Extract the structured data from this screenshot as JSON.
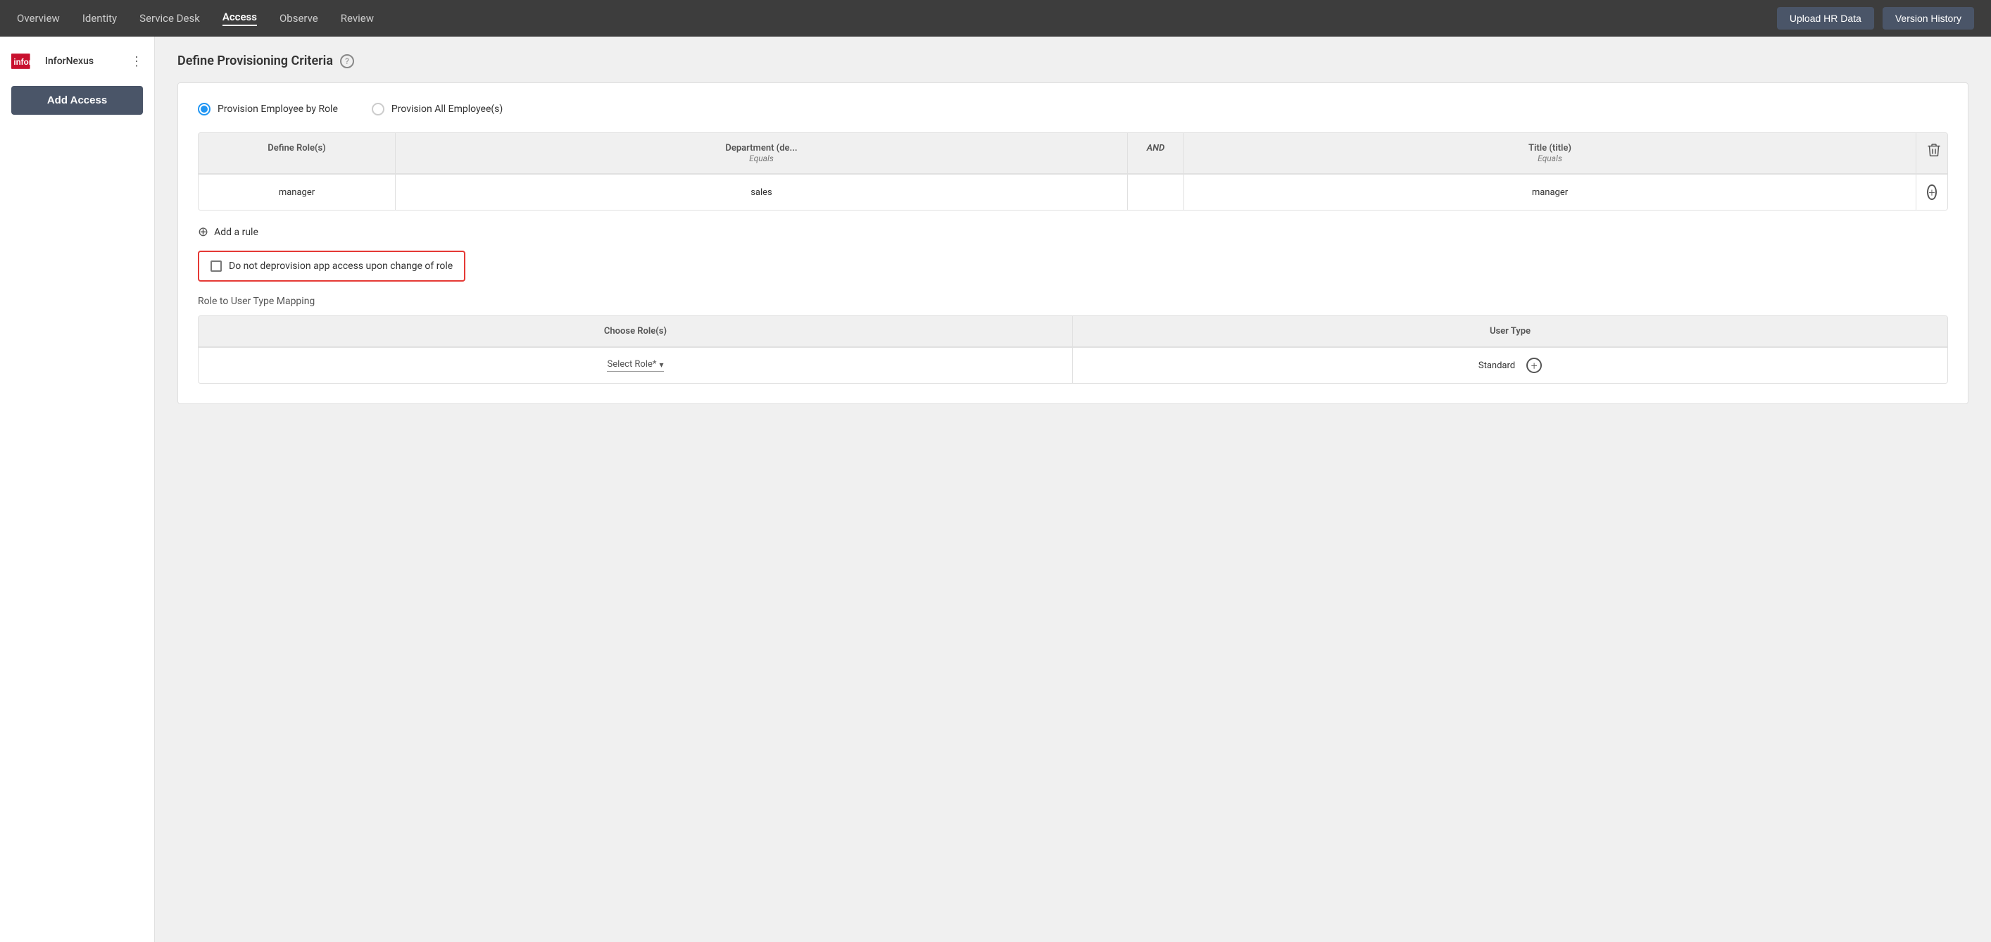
{
  "nav": {
    "links": [
      {
        "id": "overview",
        "label": "Overview",
        "active": false
      },
      {
        "id": "identity",
        "label": "Identity",
        "active": false
      },
      {
        "id": "service-desk",
        "label": "Service Desk",
        "active": false
      },
      {
        "id": "access",
        "label": "Access",
        "active": true
      },
      {
        "id": "observe",
        "label": "Observe",
        "active": false
      },
      {
        "id": "review",
        "label": "Review",
        "active": false
      }
    ],
    "upload_btn": "Upload HR Data",
    "version_btn": "Version History"
  },
  "sidebar": {
    "logo_text": "InforNexus",
    "add_access_btn": "Add Access"
  },
  "main": {
    "page_title": "Define Provisioning Criteria",
    "help_icon": "?",
    "radio_options": [
      {
        "id": "by-role",
        "label": "Provision Employee by Role",
        "selected": true
      },
      {
        "id": "all-employees",
        "label": "Provision All Employee(s)",
        "selected": false
      }
    ],
    "table": {
      "columns": [
        {
          "header": "Define Role(s)",
          "sub": ""
        },
        {
          "header": "Department (de...",
          "sub": "Equals"
        },
        {
          "header": "AND",
          "sub": ""
        },
        {
          "header": "Title (title)",
          "sub": "Equals"
        },
        {
          "header": "",
          "sub": ""
        }
      ],
      "rows": [
        {
          "role": "manager",
          "department": "sales",
          "title": "manager"
        }
      ]
    },
    "add_rule_label": "Add a rule",
    "checkbox_label": "Do not deprovision app access upon change of role",
    "role_mapping_title": "Role to User Type Mapping",
    "lower_table": {
      "columns": [
        {
          "header": "Choose Role(s)"
        },
        {
          "header": "User Type"
        }
      ],
      "rows": [
        {
          "select_placeholder": "Select Role*",
          "user_type": "Standard"
        }
      ]
    }
  },
  "icons": {
    "dots": "⋮",
    "trash": "🗑",
    "plus_circle": "+",
    "chevron_down": "▾",
    "add_rule_icon": "⊕"
  }
}
